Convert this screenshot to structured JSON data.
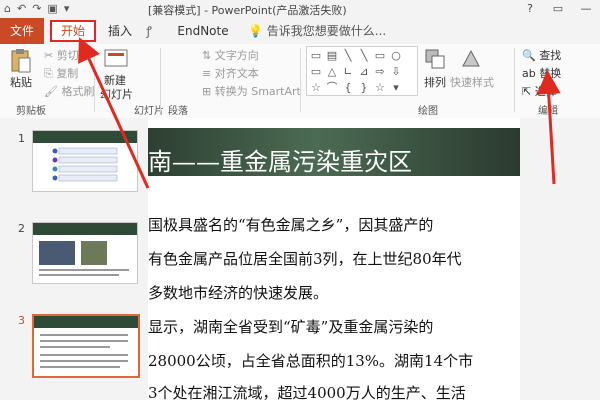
{
  "titlebar": {
    "title": "[兼容模式] - PowerPoint(产品激活失败)",
    "qat": [
      "⌂",
      "↶",
      "↷",
      "▣",
      "▾"
    ],
    "win_controls": [
      "?",
      "▭",
      "—"
    ]
  },
  "tabs": {
    "file": "文件",
    "home": "开始",
    "insert": "插入",
    "s": "ꝭ",
    "endnote": "EndNote X8",
    "tellme": "告诉我您想要做什么..."
  },
  "ribbon": {
    "paste": "粘贴",
    "cut": "剪切",
    "copy": "复制",
    "format_painter": "格式刷",
    "clipboard_label": "剪贴板",
    "new_slide_1": "新建",
    "new_slide_2": "幻灯片",
    "slides_label": "幻灯片",
    "text_direction": "文字方向",
    "align_text": "对齐文本",
    "smartart": "转换为 SmartArt",
    "paragraph_label": "段落",
    "arrange": "排列",
    "quick_styles": "快速样式",
    "drawing_label": "绘图",
    "find": "查找",
    "replace": "替换",
    "select": "选择",
    "editing_label": "编辑"
  },
  "shapes": [
    "▭",
    "▤",
    "╲",
    "╲",
    "▭",
    "○",
    "▭",
    "△",
    "∟",
    "⊿",
    "⇨",
    "⇩",
    "☆",
    "⌒",
    "{",
    "}",
    "☆",
    "▾"
  ],
  "thumbs": [
    {
      "num": "1",
      "selected": false
    },
    {
      "num": "2",
      "selected": false
    },
    {
      "num": "3",
      "selected": true
    }
  ],
  "slide": {
    "title": "南——重金属污染重灾区",
    "paragraphs": [
      "国极具盛名的“有色金属之乡”，因其盛产的",
      "有色金属产品位居全国前3列，在上世纪80年代",
      "多数地市经济的快速发展。",
      "显示，湖南全省受到“矿毒”及重金属污染的",
      "28000公顷，占全省总面积的13%。湖南14个市",
      "3个处在湘江流域，超过4000万人的生产、生活"
    ]
  },
  "colors": {
    "accent": "#c94a24",
    "annotation_red": "#e02a1f",
    "slide_header": "#2d3f32"
  }
}
